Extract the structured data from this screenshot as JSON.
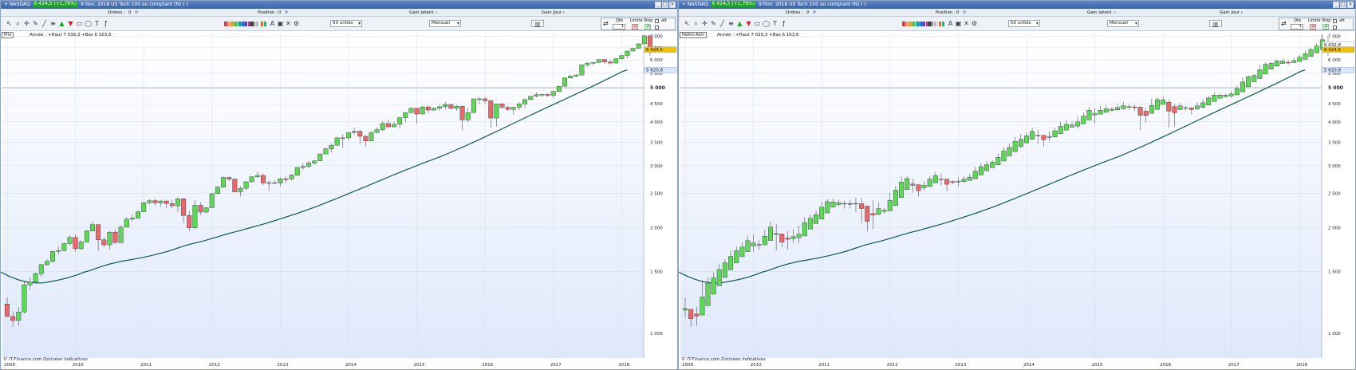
{
  "panes": [
    {
      "window_title": "+ NASDAQ",
      "change": "6 424,5 (+1,79%)",
      "instrument": "9 févr. 2018 US Tech 100 au comptant (N) ( )",
      "price_type_tag": "Prix",
      "range_info": "Année : +Haut 7 039,3 +Bas 6 163,6"
    },
    {
      "window_title": "+ NASDAQ",
      "change": "6 424,5 (+1,79%)",
      "instrument": "9 févr. 2018 US Tech 100 au comptant (N) ( )",
      "price_type_tag": "Heikin-Ashi",
      "range_info": "Année : +Haut 7 039,3 +Bas 6 163,6"
    }
  ],
  "toolbar": {
    "orders_label": "Ordres :",
    "orders_value": "0",
    "position_label": "Position :",
    "position_value": "0",
    "gain_latent_label": "Gain latent :",
    "gain_latent_value": "-",
    "gain_jour_label": "Gain Jour :",
    "gain_jour_value": "-",
    "units_select": "50 unités",
    "period_select": "Mensuel",
    "qty_label": "Qté",
    "qty_value": "1",
    "limit_label": "Limite",
    "stop_label": "Stop",
    "att_label": "att"
  },
  "footer": "© IT-Finance.com Données indicatives",
  "icons": [
    "cursor-icon",
    "zoom-icon",
    "crosshair-icon",
    "pencil-icon",
    "line-icon",
    "fibonacci-icon",
    "arrow-up-icon",
    "arrow-down-icon",
    "rectangle-icon",
    "ellipse-icon",
    "text-icon",
    "indicator-icon"
  ],
  "colors": {
    "up": "#5fd65a",
    "down": "#e8696b",
    "ma": "#0f5a4a",
    "bg_bottom": "#dfe8fb",
    "title_bar": "#3a62a8",
    "last_price": "#f2c200",
    "ma_label": "#d9e7ff"
  },
  "price_labels": {
    "last": "6 424,5",
    "ma": "5 620,8",
    "prev_close": "6 632,8"
  },
  "chart_data": [
    {
      "type": "candlestick",
      "title": "",
      "xlabel": "",
      "ylabel": "",
      "x_ticks": [
        "2009",
        "2010",
        "2011",
        "2012",
        "2013",
        "2014",
        "2015",
        "2016",
        "2017",
        "2018"
      ],
      "y_ticks": [
        "1 000",
        "1 500",
        "2 000",
        "2 500",
        "3 000",
        "3 500",
        "4 000",
        "4 500",
        "5 000",
        "5 500",
        "6 000",
        "6 500",
        "7 000"
      ],
      "ylim": [
        850,
        7100
      ],
      "y_scale": "log",
      "grid": true,
      "last_price": 6424.5,
      "ma_last": 5620.8,
      "series": [
        {
          "name": "",
          "kind": "candles",
          "start": "2009-01",
          "ohlc": [
            [
              1211,
              1265,
              1113,
              1116
            ],
            [
              1116,
              1155,
              1043,
              1087
            ],
            [
              1087,
              1188,
              1050,
              1150
            ],
            [
              1150,
              1410,
              1140,
              1373
            ],
            [
              1373,
              1445,
              1330,
              1398
            ],
            [
              1398,
              1490,
              1390,
              1478
            ],
            [
              1478,
              1578,
              1450,
              1568
            ],
            [
              1568,
              1625,
              1555,
              1602
            ],
            [
              1602,
              1720,
              1587,
              1710
            ],
            [
              1710,
              1765,
              1675,
              1720
            ],
            [
              1720,
              1812,
              1710,
              1800
            ],
            [
              1800,
              1895,
              1776,
              1875
            ],
            [
              1875,
              1910,
              1705,
              1740
            ],
            [
              1740,
              1838,
              1726,
              1820
            ],
            [
              1820,
              1967,
              1812,
              1957
            ],
            [
              1957,
              2080,
              1950,
              2038
            ],
            [
              2038,
              2044,
              1720,
              1845
            ],
            [
              1845,
              1876,
              1758,
              1785
            ],
            [
              1785,
              1952,
              1730,
              1940
            ],
            [
              1940,
              1977,
              1806,
              1812
            ],
            [
              1812,
              2025,
              1810,
              2005
            ],
            [
              2005,
              2140,
              2003,
              2112
            ],
            [
              2112,
              2180,
              2083,
              2127
            ],
            [
              2127,
              2237,
              2125,
              2218
            ],
            [
              2218,
              2365,
              2211,
              2353
            ],
            [
              2353,
              2412,
              2328,
              2385
            ],
            [
              2385,
              2420,
              2310,
              2350
            ],
            [
              2350,
              2400,
              2290,
              2380
            ],
            [
              2380,
              2385,
              2266,
              2340
            ],
            [
              2340,
              2395,
              2270,
              2306
            ],
            [
              2306,
              2435,
              2215,
              2415
            ],
            [
              2415,
              2425,
              2060,
              2163
            ],
            [
              2163,
              2227,
              1950,
              1996
            ],
            [
              1996,
              2395,
              1980,
              2314
            ],
            [
              2314,
              2360,
              2170,
              2213
            ],
            [
              2213,
              2280,
              2190,
              2278
            ],
            [
              2278,
              2505,
              2277,
              2497
            ],
            [
              2497,
              2630,
              2493,
              2605
            ],
            [
              2605,
              2795,
              2595,
              2777
            ],
            [
              2777,
              2797,
              2710,
              2747
            ],
            [
              2747,
              2760,
              2517,
              2528
            ],
            [
              2528,
              2620,
              2450,
              2587
            ],
            [
              2587,
              2710,
              2550,
              2699
            ],
            [
              2699,
              2800,
              2695,
              2790
            ],
            [
              2790,
              2880,
              2770,
              2814
            ],
            [
              2814,
              2850,
              2640,
              2680
            ],
            [
              2680,
              2722,
              2540,
              2683
            ],
            [
              2683,
              2730,
              2660,
              2680
            ],
            [
              2680,
              2780,
              2620,
              2752
            ],
            [
              2752,
              2800,
              2680,
              2750
            ],
            [
              2750,
              2840,
              2720,
              2820
            ],
            [
              2820,
              2980,
              2805,
              2965
            ],
            [
              2965,
              3055,
              2920,
              2987
            ],
            [
              2987,
              3090,
              2954,
              3052
            ],
            [
              3052,
              3110,
              3020,
              3097
            ],
            [
              3097,
              3250,
              3090,
              3240
            ],
            [
              3240,
              3380,
              3240,
              3350
            ],
            [
              3350,
              3470,
              3270,
              3430
            ],
            [
              3430,
              3625,
              3420,
              3600
            ],
            [
              3600,
              3690,
              3370,
              3599
            ],
            [
              3599,
              3730,
              3530,
              3730
            ],
            [
              3730,
              3850,
              3680,
              3760
            ],
            [
              3760,
              3800,
              3460,
              3638
            ],
            [
              3638,
              3660,
              3400,
              3530
            ],
            [
              3530,
              3760,
              3520,
              3730
            ],
            [
              3730,
              3850,
              3700,
              3800
            ],
            [
              3800,
              4010,
              3760,
              3955
            ],
            [
              3955,
              4050,
              3860,
              3870
            ],
            [
              3870,
              4010,
              3862,
              3935
            ],
            [
              3935,
              4140,
              3820,
              4110
            ],
            [
              4110,
              4250,
              3990,
              4250
            ],
            [
              4250,
              4400,
              4240,
              4370
            ],
            [
              4370,
              4380,
              3960,
              4209
            ],
            [
              4209,
              4440,
              4195,
              4410
            ],
            [
              4410,
              4460,
              4240,
              4320
            ],
            [
              4320,
              4400,
              4290,
              4371
            ],
            [
              4371,
              4490,
              4300,
              4414
            ],
            [
              4414,
              4560,
              4330,
              4480
            ],
            [
              4480,
              4490,
              4330,
              4367
            ],
            [
              4367,
              4470,
              4300,
              4430
            ],
            [
              4430,
              4430,
              3790,
              4050
            ],
            [
              4050,
              4390,
              3990,
              4250
            ],
            [
              4250,
              4650,
              4250,
              4650
            ],
            [
              4650,
              4700,
              4500,
              4650
            ],
            [
              4650,
              4710,
              4500,
              4590
            ],
            [
              4590,
              4620,
              3850,
              4100
            ],
            [
              4100,
              4500,
              3880,
              4500
            ],
            [
              4500,
              4520,
              4350,
              4400
            ],
            [
              4400,
              4445,
              4300,
              4340
            ],
            [
              4340,
              4410,
              4190,
              4400
            ],
            [
              4400,
              4550,
              4320,
              4497
            ],
            [
              4497,
              4640,
              4360,
              4630
            ],
            [
              4630,
              4735,
              4605,
              4730
            ],
            [
              4730,
              4850,
              4700,
              4780
            ],
            [
              4780,
              4800,
              4700,
              4788
            ],
            [
              4788,
              4810,
              4700,
              4760
            ],
            [
              4760,
              4900,
              4680,
              4880
            ],
            [
              4880,
              5070,
              4870,
              5050
            ],
            [
              5050,
              5350,
              5040,
              5330
            ],
            [
              5330,
              5440,
              5320,
              5400
            ],
            [
              5400,
              5480,
              5370,
              5435
            ],
            [
              5435,
              5830,
              5430,
              5813
            ],
            [
              5813,
              5900,
              5740,
              5880
            ],
            [
              5880,
              5910,
              5800,
              5900
            ],
            [
              5900,
              6020,
              5900,
              6020
            ],
            [
              6020,
              6030,
              5850,
              5920
            ],
            [
              5920,
              6000,
              5820,
              5880
            ],
            [
              5880,
              6080,
              5880,
              6050
            ],
            [
              6050,
              6190,
              6020,
              6180
            ],
            [
              6180,
              6380,
              6080,
              6360
            ],
            [
              6360,
              6490,
              6380,
              6480
            ],
            [
              6480,
              6690,
              6450,
              6670
            ],
            [
              6670,
              7050,
              6650,
              7030
            ],
            [
              7030,
              7040,
              6160,
              6424
            ]
          ]
        },
        {
          "name": "",
          "kind": "moving-average",
          "start": "2007-01",
          "values": [
            1760,
            1740,
            1720,
            1705,
            1690,
            1680,
            1670,
            1660,
            1645,
            1630,
            1610,
            1590,
            1565,
            1540,
            1515,
            1490,
            1470,
            1450,
            1435,
            1420,
            1410,
            1400,
            1395,
            1392,
            1390,
            1392,
            1398,
            1405,
            1412,
            1420,
            1430,
            1440,
            1452,
            1465,
            1480,
            1495,
            1505,
            1520,
            1535,
            1550,
            1562,
            1575,
            1585,
            1595,
            1605,
            1612,
            1620,
            1628,
            1636,
            1645,
            1655,
            1665,
            1676,
            1688,
            1700,
            1713,
            1728,
            1744,
            1760,
            1776,
            1790,
            1803,
            1815,
            1826,
            1840,
            1855,
            1870,
            1885,
            1900,
            1916,
            1930,
            1945,
            1958,
            1973,
            1988,
            2003,
            2018,
            2033,
            2049,
            2066,
            2084,
            2102,
            2120,
            2139,
            2158,
            2177,
            2197,
            2218,
            2240,
            2262,
            2285,
            2309,
            2333,
            2358,
            2384,
            2410,
            2437,
            2464,
            2492,
            2520,
            2549,
            2578,
            2608,
            2638,
            2668,
            2698,
            2729,
            2760,
            2792,
            2824,
            2856,
            2888,
            2920,
            2952,
            2984,
            3016,
            3048,
            3080,
            3112,
            3144,
            3178,
            3213,
            3250,
            3288,
            3327,
            3367,
            3408,
            3450,
            3493,
            3537,
            3582,
            3628,
            3676,
            3724,
            3772,
            3822,
            3872,
            3923,
            3975,
            4027,
            4080,
            4133,
            4187,
            4241,
            4296,
            4352,
            4408,
            4464,
            4521,
            4578,
            4636,
            4695,
            4755,
            4816,
            4878,
            4941,
            5006,
            5072,
            5140,
            5210,
            5280,
            5352,
            5425,
            5500,
            5575,
            5620
          ]
        }
      ]
    },
    {
      "type": "candlestick-heikin-ashi",
      "title": "",
      "xlabel": "",
      "ylabel": "",
      "x_ticks": [
        "2009",
        "2010",
        "2011",
        "2012",
        "2013",
        "2014",
        "2015",
        "2016",
        "2017",
        "2018"
      ],
      "y_ticks": [
        "1 000",
        "1 500",
        "2 000",
        "2 500",
        "3 000",
        "3 500",
        "4 000",
        "4 500",
        "5 000",
        "5 500",
        "6 000",
        "6 500",
        "7 000"
      ],
      "ylim": [
        850,
        7100
      ],
      "y_scale": "log",
      "grid": true,
      "last_price": 6424.5,
      "ma_last": 5620.8,
      "prev_close": 6632.8,
      "series": [
        {
          "name": "",
          "kind": "heikin-ashi",
          "derived_from": "chart_data.0.series.0"
        },
        {
          "name": "",
          "kind": "moving-average",
          "derived_from": "chart_data.0.series.1"
        }
      ]
    }
  ]
}
